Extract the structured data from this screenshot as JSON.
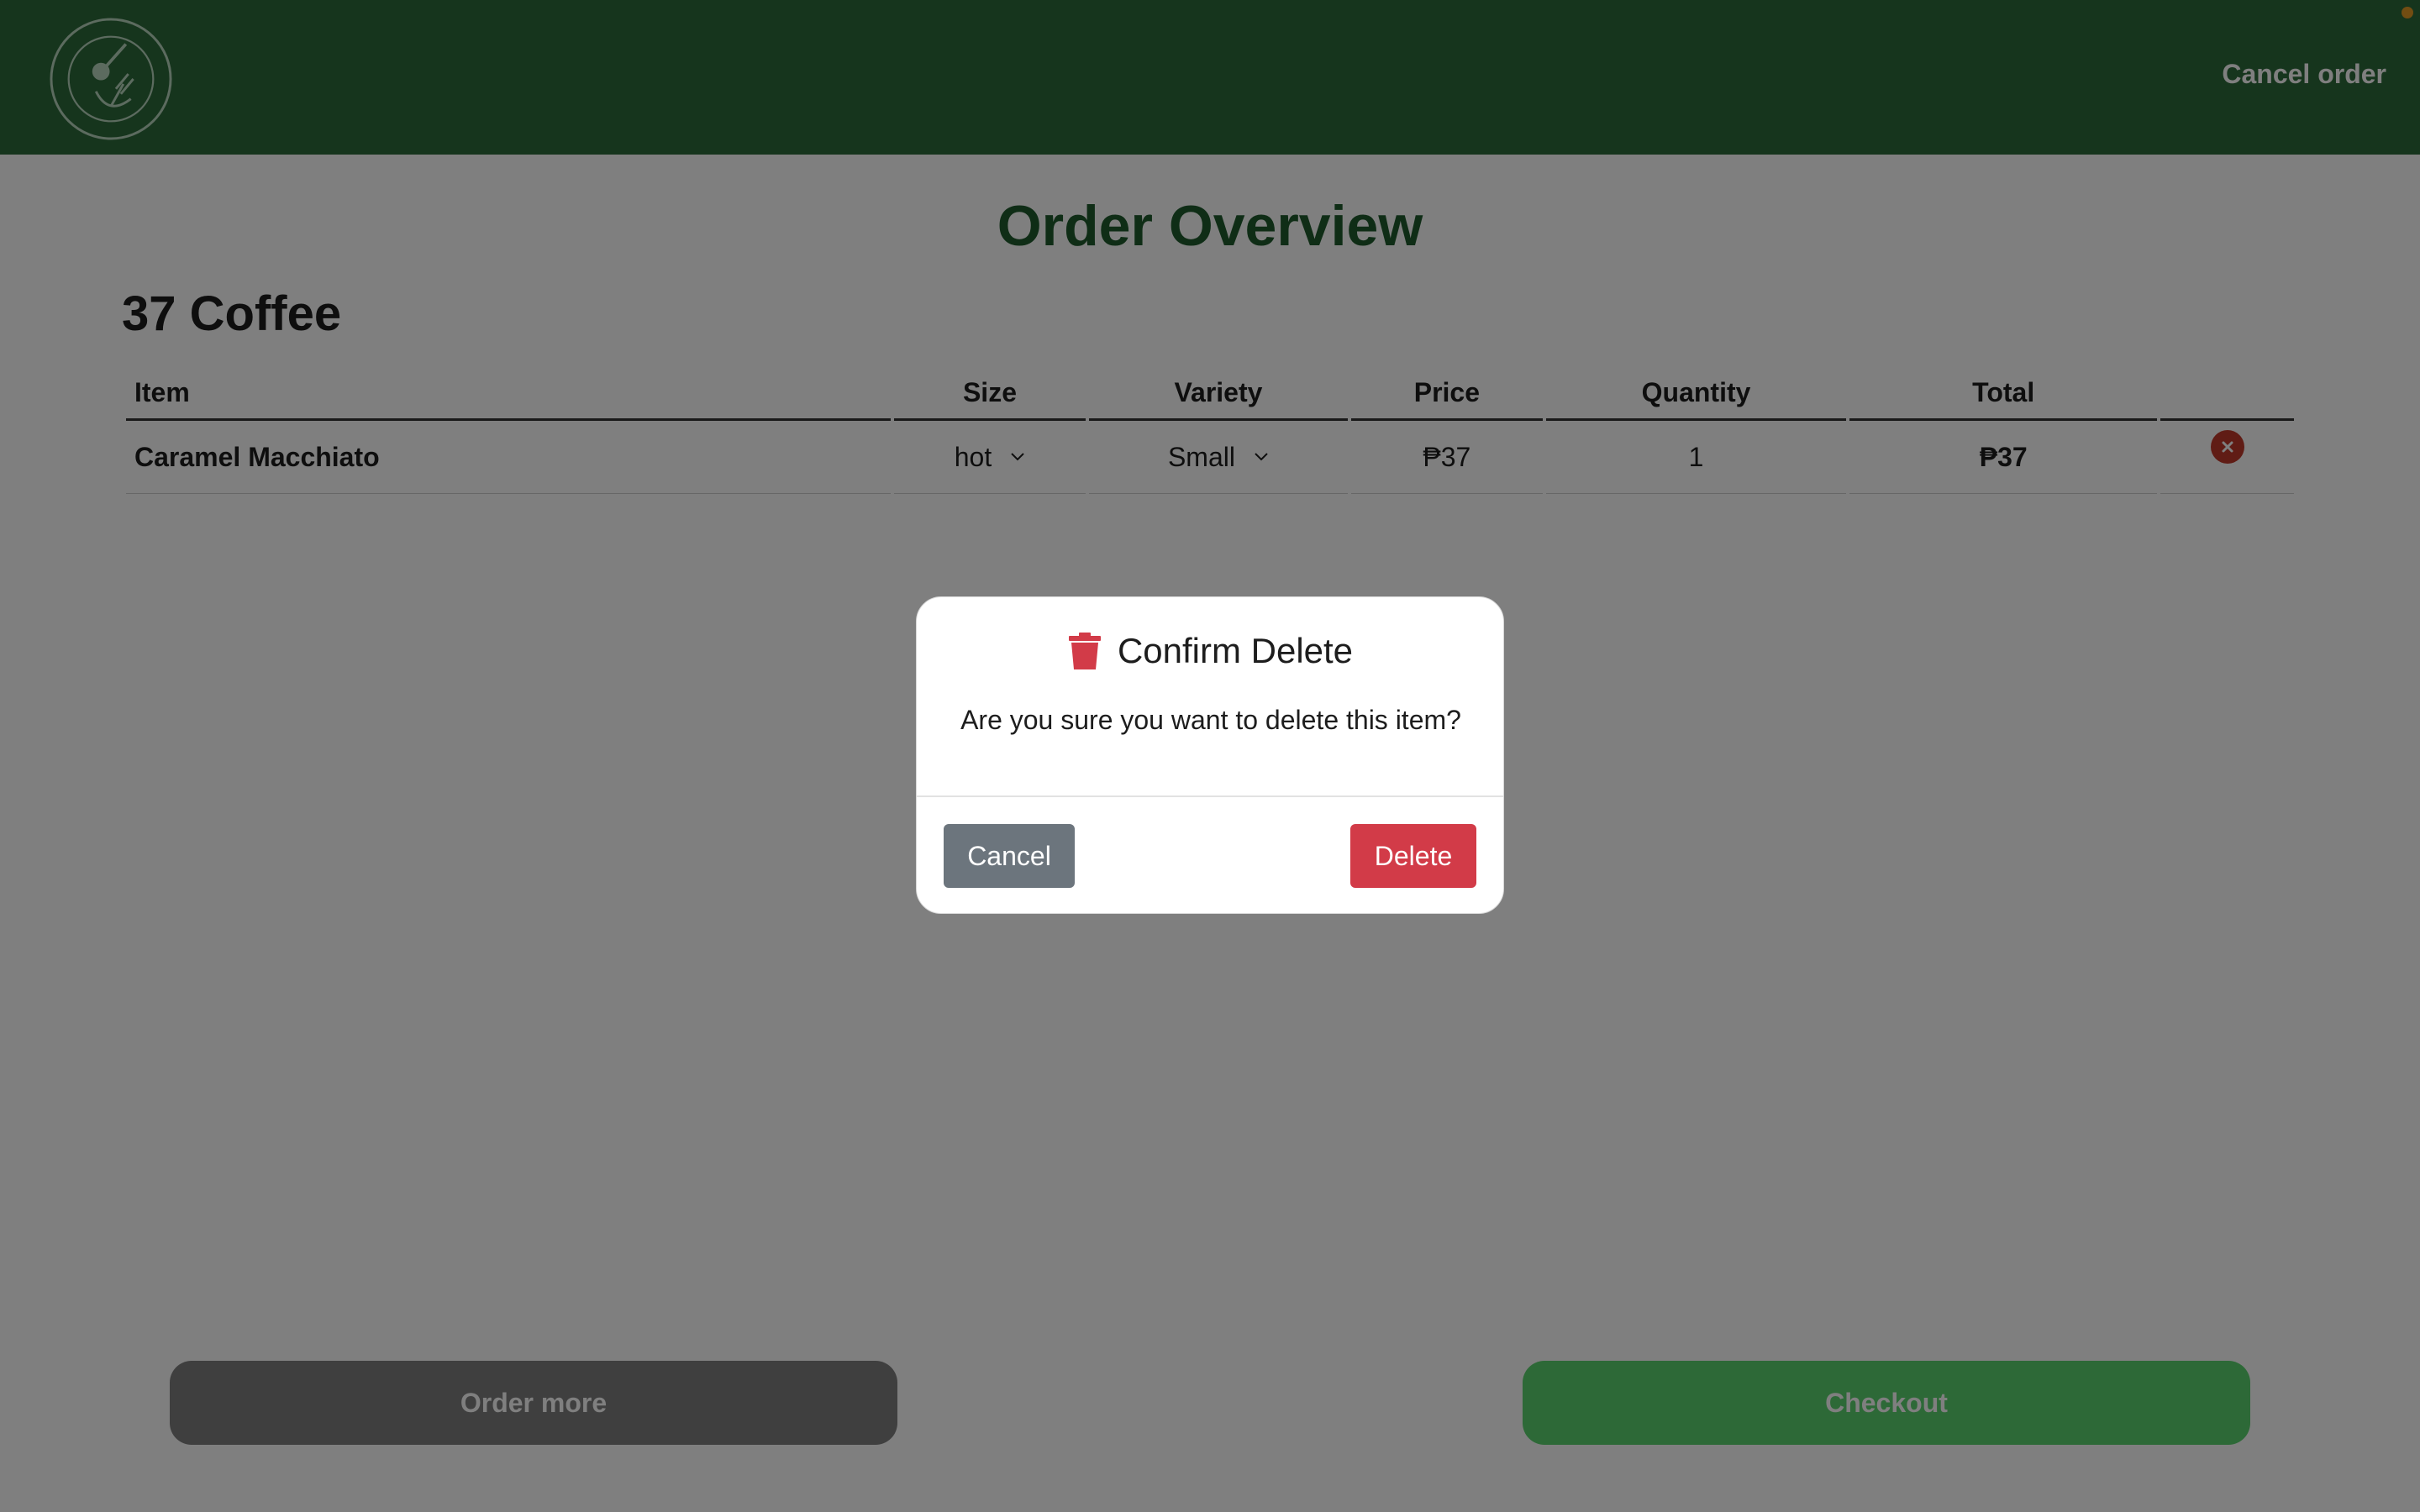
{
  "header": {
    "cancel_order_label": "Cancel order",
    "logo_icon": "meet-n-eat-logo"
  },
  "main": {
    "title": "Order Overview",
    "store_name": "37 Coffee",
    "table": {
      "columns": [
        "Item",
        "Size",
        "Variety",
        "Price",
        "Quantity",
        "Total"
      ],
      "rows": [
        {
          "item": "Caramel Macchiato",
          "size": "hot",
          "variety": "Small",
          "price": "₱37",
          "quantity": "1",
          "total": "₱37"
        }
      ]
    }
  },
  "footer": {
    "order_more_label": "Order more",
    "checkout_label": "Checkout"
  },
  "modal": {
    "title": "Confirm Delete",
    "message": "Are you sure you want to delete this item?",
    "cancel_label": "Cancel",
    "delete_label": "Delete",
    "icon": "trash-icon"
  },
  "colors": {
    "header_green": "#2d6a3a",
    "title_green": "#1f5a2c",
    "checkout_green": "#5ad26f",
    "delete_red": "#d23b48",
    "cancel_gray": "#6c757d"
  }
}
